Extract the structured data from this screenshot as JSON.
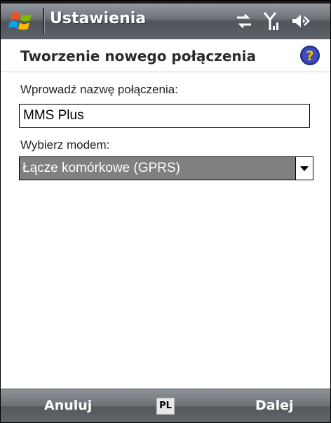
{
  "titlebar": {
    "title": "Ustawienia",
    "icons": [
      "windows-start-icon",
      "data-connection-icon",
      "signal-strength-icon",
      "volume-icon"
    ]
  },
  "page": {
    "title": "Tworzenie nowego połączenia",
    "help_icon": "help-icon"
  },
  "form": {
    "name_label": "Wprowadź nazwę połączenia:",
    "name_value": "MMS Plus",
    "modem_label": "Wybierz modem:",
    "modem_selected": "Łącze komórkowe (GPRS)"
  },
  "softkeys": {
    "left": "Anuluj",
    "input_language": "PL",
    "right": "Dalej"
  },
  "colors": {
    "titlebar": "#6e747a",
    "selection": "#808080",
    "help_badge": "#f2c200"
  }
}
